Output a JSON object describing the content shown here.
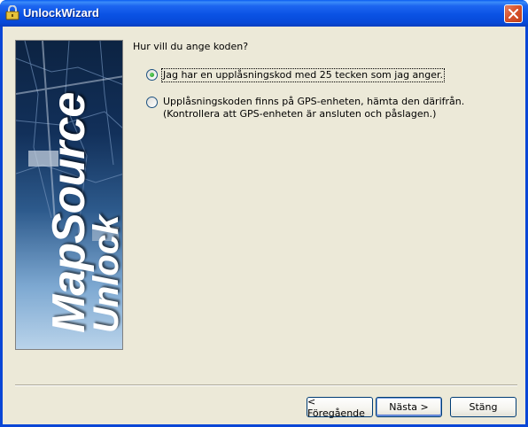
{
  "window": {
    "title": "UnlockWizard"
  },
  "banner": {
    "brand_line1": "MapSource",
    "brand_line2": "Unlock"
  },
  "main": {
    "question": "Hur vill du ange koden?",
    "options": [
      {
        "label": "Jag har en upplåsningskod med 25 tecken som jag anger.",
        "checked": true
      },
      {
        "label_line1": "Upplåsningskoden finns på GPS-enheten, hämta den därifrån.",
        "label_line2": "(Kontrollera att GPS-enheten är ansluten och påslagen.)",
        "checked": false
      }
    ]
  },
  "footer": {
    "back_label": "< Föregående",
    "next_label": "Nästa >",
    "close_label": "Stäng"
  },
  "colors": {
    "titlebar": "#0a52e4",
    "client_bg": "#ece9d8",
    "close_button": "#d9542c",
    "radio_dot": "#21a121"
  },
  "icons": {
    "title": "app-lock-icon",
    "close": "close-x-icon"
  }
}
